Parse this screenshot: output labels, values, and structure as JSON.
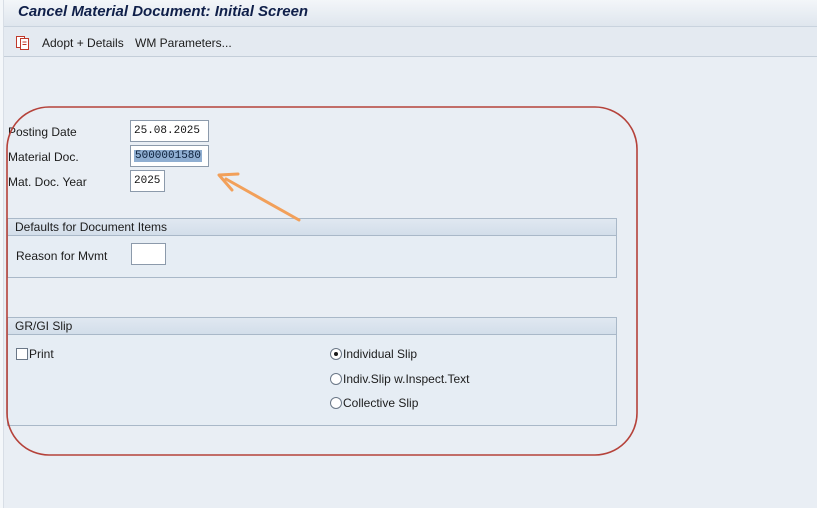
{
  "title": "Cancel Material Document: Initial Screen",
  "toolbar": {
    "adopt_details": "Adopt + Details",
    "wm_parameters": "WM Parameters..."
  },
  "form": {
    "posting_date": {
      "label": "Posting Date",
      "value": "25.08.2025"
    },
    "material_doc": {
      "label": "Material Doc.",
      "value": "5000001580"
    },
    "mat_doc_year": {
      "label": "Mat. Doc. Year",
      "value": "2025"
    }
  },
  "defaults_group": {
    "title": "Defaults for Document Items",
    "reason_label": "Reason for Mvmt",
    "reason_value": ""
  },
  "slip_group": {
    "title": "GR/GI Slip",
    "print_label": "Print",
    "print_checked": false,
    "options": [
      {
        "label": "Individual Slip",
        "selected": true
      },
      {
        "label": "Indiv.Slip w.Inspect.Text",
        "selected": false
      },
      {
        "label": "Collective Slip",
        "selected": false
      }
    ]
  },
  "colors": {
    "highlight_outline": "#b5423a",
    "arrow": "#f2a05a",
    "title_text": "#10204a",
    "selection": "#8faed1"
  },
  "icons": {
    "adopt_details": "copy-document-icon"
  }
}
